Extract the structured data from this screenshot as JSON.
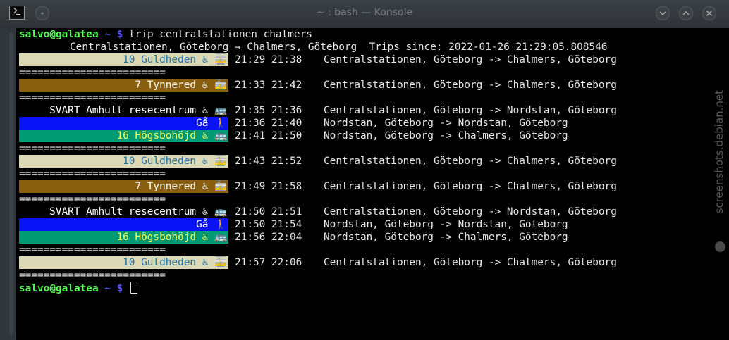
{
  "window": {
    "title": "~ : bash — Konsole"
  },
  "prompt": {
    "user_host": "salvo@galatea",
    "path": "~",
    "symbol": "$"
  },
  "command": "trip centralstationen chalmers",
  "header_line": "Centralstationen, Göteborg → Chalmers, Göteborg  Trips since: 2022-01-26 21:29:05.808546",
  "separator": "========================",
  "trips": [
    {
      "legs": [
        {
          "label": "10 Guldheden ♿ 🚋",
          "bg": "#dbd9b6",
          "fg": "#1d6fa3",
          "times": "21:29 21:38",
          "route": "Centralstationen, Göteborg -> Chalmers, Göteborg"
        }
      ]
    },
    {
      "legs": [
        {
          "label": "7 Tynnered ♿ 🚋",
          "bg": "#8a5e0f",
          "fg": "#ffffff",
          "times": "21:33 21:42",
          "route": "Centralstationen, Göteborg -> Chalmers, Göteborg"
        }
      ]
    },
    {
      "legs": [
        {
          "label": "SVART Amhult resecentrum ♿ 🚌",
          "bg": "#000000",
          "fg": "#ffffff",
          "times": "21:35 21:36",
          "route": "Centralstationen, Göteborg -> Nordstan, Göteborg"
        },
        {
          "label": "Gå 🚶",
          "bg": "#0a13f5",
          "fg": "#ffffff",
          "times": "21:36 21:40",
          "route": "Nordstan, Göteborg -> Nordstan, Göteborg"
        },
        {
          "label": "16 Högsbohöjd ♿ 🚌",
          "bg": "#009a72",
          "fg": "#ffff55",
          "times": "21:41 21:50",
          "route": "Nordstan, Göteborg -> Chalmers, Göteborg"
        }
      ]
    },
    {
      "legs": [
        {
          "label": "10 Guldheden ♿ 🚋",
          "bg": "#dbd9b6",
          "fg": "#1d6fa3",
          "times": "21:43 21:52",
          "route": "Centralstationen, Göteborg -> Chalmers, Göteborg"
        }
      ]
    },
    {
      "legs": [
        {
          "label": "7 Tynnered ♿ 🚋",
          "bg": "#8a5e0f",
          "fg": "#ffffff",
          "times": "21:49 21:58",
          "route": "Centralstationen, Göteborg -> Chalmers, Göteborg"
        }
      ]
    },
    {
      "legs": [
        {
          "label": "SVART Amhult resecentrum ♿ 🚌",
          "bg": "#000000",
          "fg": "#ffffff",
          "times": "21:50 21:51",
          "route": "Centralstationen, Göteborg -> Nordstan, Göteborg"
        },
        {
          "label": "Gå 🚶",
          "bg": "#0a13f5",
          "fg": "#ffffff",
          "times": "21:50 21:54",
          "route": "Nordstan, Göteborg -> Nordstan, Göteborg"
        },
        {
          "label": "16 Högsbohöjd ♿ 🚌",
          "bg": "#009a72",
          "fg": "#ffff55",
          "times": "21:56 22:04",
          "route": "Nordstan, Göteborg -> Chalmers, Göteborg"
        }
      ]
    },
    {
      "legs": [
        {
          "label": "10 Guldheden ♿ 🚋",
          "bg": "#dbd9b6",
          "fg": "#1d6fa3",
          "times": "21:57 22:06",
          "route": "Centralstationen, Göteborg -> Chalmers, Göteborg"
        }
      ]
    }
  ],
  "icons": {
    "minimize": "chevron-down-icon",
    "maximize": "chevron-up-icon",
    "close": "close-icon",
    "app": "terminal-icon"
  },
  "colors": {
    "prompt_user": "#54ff54",
    "prompt_path": "#5555ff",
    "terminal_bg": "#000000"
  }
}
